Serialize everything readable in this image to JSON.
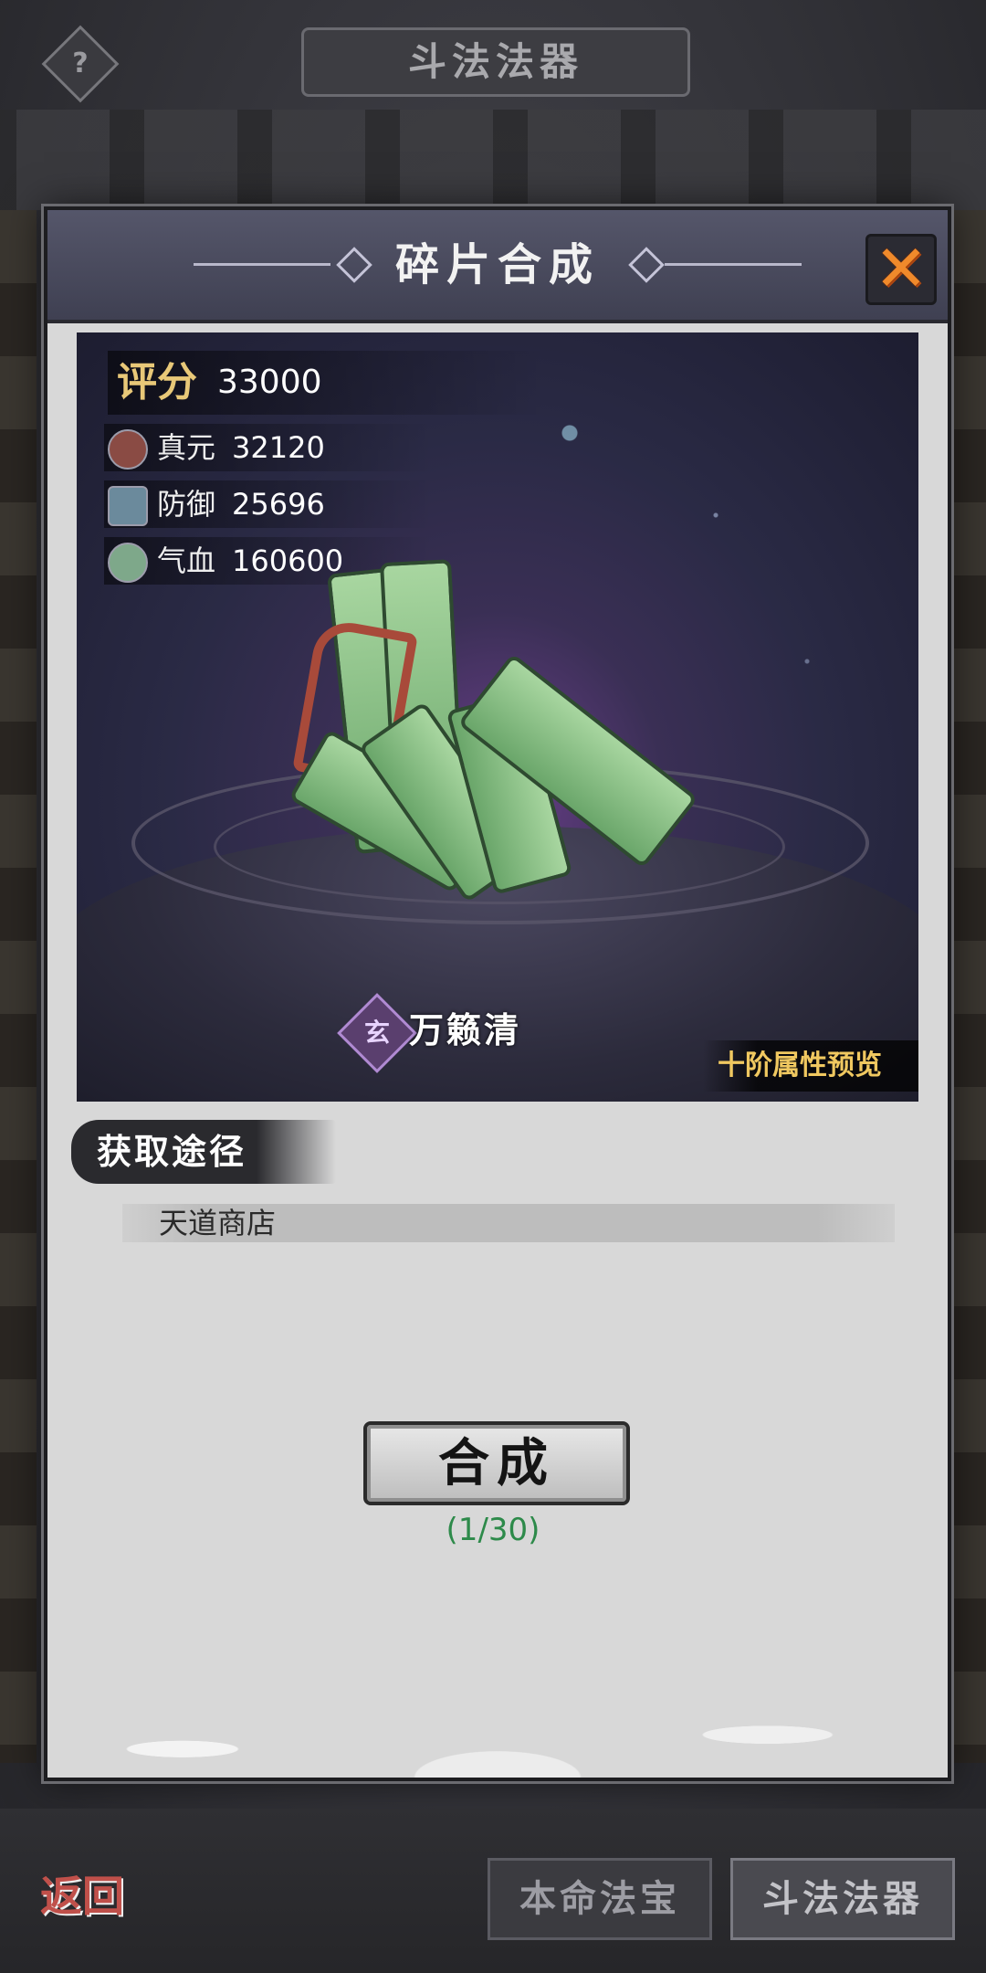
{
  "top_bar": {
    "help_label": "?",
    "title": "斗法法器"
  },
  "dialog": {
    "title": "碎片合成",
    "close_label": "✕",
    "score": {
      "label": "评分",
      "value": "33000"
    },
    "stats": [
      {
        "name": "真元",
        "value": "32120",
        "icon": "attack-icon"
      },
      {
        "name": "防御",
        "value": "25696",
        "icon": "shield-icon"
      },
      {
        "name": "气血",
        "value": "160600",
        "icon": "heart-icon"
      }
    ],
    "artifact": {
      "emblem": "玄",
      "name": "万籁清"
    },
    "preview_tag": "十阶属性预览",
    "source": {
      "heading": "获取途径",
      "items": [
        "天道商店"
      ]
    },
    "synthesize": {
      "label": "合成",
      "count": "(1/30)"
    }
  },
  "bottom_nav": {
    "back_label": "返回",
    "tabs": [
      {
        "label": "本命法宝",
        "active": false
      },
      {
        "label": "斗法法器",
        "active": true
      }
    ]
  },
  "colors": {
    "score_label": "#e8c878",
    "preview_tag": "#f0c860",
    "count_green": "#2d8a4a",
    "close_orange": "#f08a2b"
  }
}
